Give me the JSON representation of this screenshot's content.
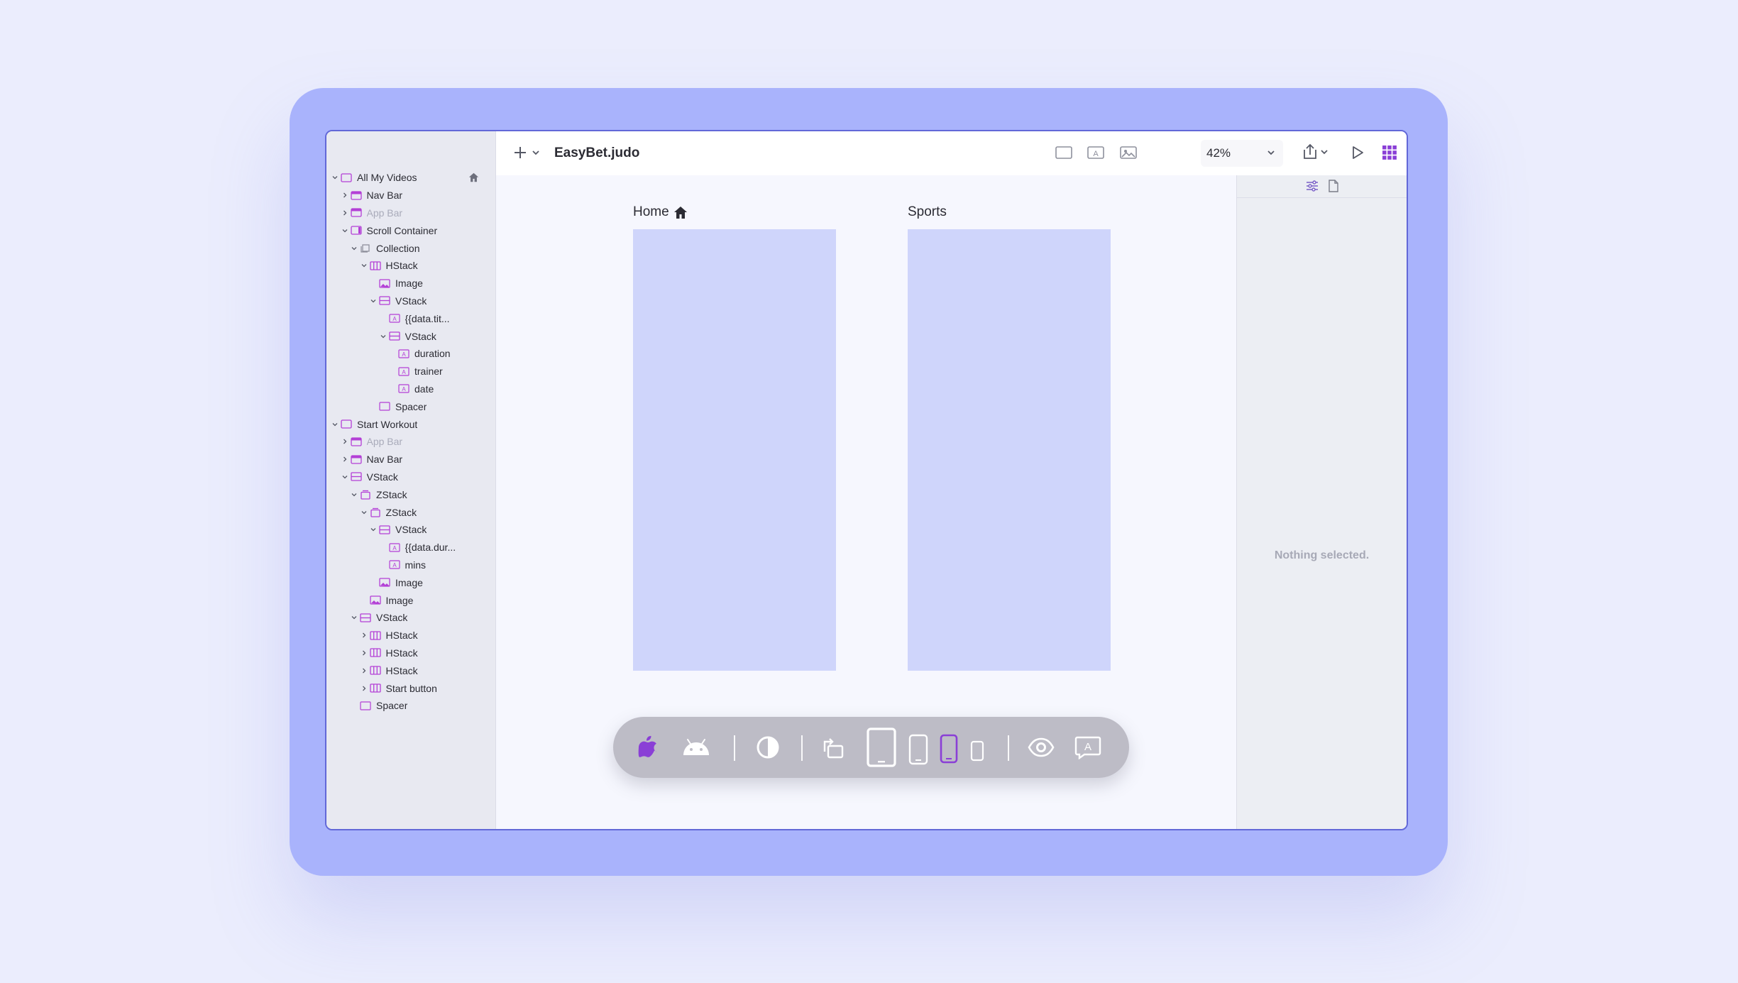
{
  "app": {
    "file_name": "EasyBet.judo",
    "zoom": "42%"
  },
  "colors": {
    "accent": "#8a3fd6",
    "frame_fill": "#cfd5fb",
    "device_bezel": "#a9b3fc"
  },
  "layers": [
    {
      "label": "All My Videos",
      "depth": 0,
      "expanded": true,
      "icon": "screen-icon",
      "dim": false,
      "home": true
    },
    {
      "label": "Nav Bar",
      "depth": 1,
      "expanded": false,
      "icon": "navbar-icon",
      "dim": false
    },
    {
      "label": "App Bar",
      "depth": 1,
      "expanded": false,
      "icon": "navbar-icon",
      "dim": true
    },
    {
      "label": "Scroll Container",
      "depth": 1,
      "expanded": true,
      "icon": "scroll-icon",
      "dim": false
    },
    {
      "label": "Collection",
      "depth": 2,
      "expanded": true,
      "icon": "collection-icon",
      "dim": false
    },
    {
      "label": "HStack",
      "depth": 3,
      "expanded": true,
      "icon": "hstack-icon",
      "dim": false
    },
    {
      "label": "Image",
      "depth": 4,
      "icon": "image-icon",
      "dim": false
    },
    {
      "label": "VStack",
      "depth": 4,
      "expanded": true,
      "icon": "vstack-icon",
      "dim": false
    },
    {
      "label": "{{data.tit...",
      "depth": 5,
      "icon": "text-icon",
      "dim": false
    },
    {
      "label": "VStack",
      "depth": 5,
      "expanded": true,
      "icon": "vstack-icon",
      "dim": false
    },
    {
      "label": "duration",
      "depth": 6,
      "icon": "text-icon",
      "dim": false
    },
    {
      "label": "trainer",
      "depth": 6,
      "icon": "text-icon",
      "dim": false
    },
    {
      "label": "date",
      "depth": 6,
      "icon": "text-icon",
      "dim": false
    },
    {
      "label": "Spacer",
      "depth": 4,
      "icon": "spacer-icon",
      "dim": false
    },
    {
      "label": "Start Workout",
      "depth": 0,
      "expanded": true,
      "icon": "screen-icon",
      "dim": false
    },
    {
      "label": "App Bar",
      "depth": 1,
      "expanded": false,
      "icon": "navbar-icon",
      "dim": true
    },
    {
      "label": "Nav Bar",
      "depth": 1,
      "expanded": false,
      "icon": "navbar-icon",
      "dim": false
    },
    {
      "label": "VStack",
      "depth": 1,
      "expanded": true,
      "icon": "vstack-icon",
      "dim": false
    },
    {
      "label": "ZStack",
      "depth": 2,
      "expanded": true,
      "icon": "zstack-icon",
      "dim": false
    },
    {
      "label": "ZStack",
      "depth": 3,
      "expanded": true,
      "icon": "zstack-icon",
      "dim": false
    },
    {
      "label": "VStack",
      "depth": 4,
      "expanded": true,
      "icon": "vstack-icon",
      "dim": false
    },
    {
      "label": "{{data.dur...",
      "depth": 5,
      "icon": "text-icon",
      "dim": false
    },
    {
      "label": "mins",
      "depth": 5,
      "icon": "text-icon",
      "dim": false
    },
    {
      "label": "Image",
      "depth": 4,
      "icon": "image-icon",
      "dim": false
    },
    {
      "label": "Image",
      "depth": 3,
      "icon": "image-icon",
      "dim": false
    },
    {
      "label": "VStack",
      "depth": 2,
      "expanded": true,
      "icon": "vstack-icon",
      "dim": false
    },
    {
      "label": "HStack",
      "depth": 3,
      "expanded": false,
      "icon": "hstack-icon",
      "dim": false
    },
    {
      "label": "HStack",
      "depth": 3,
      "expanded": false,
      "icon": "hstack-icon",
      "dim": false
    },
    {
      "label": "HStack",
      "depth": 3,
      "expanded": false,
      "icon": "hstack-icon",
      "dim": false
    },
    {
      "label": "Start button",
      "depth": 3,
      "expanded": false,
      "icon": "hstack-icon",
      "dim": false
    },
    {
      "label": "Spacer",
      "depth": 2,
      "icon": "spacer-icon",
      "dim": false
    }
  ],
  "canvas": {
    "frames": [
      {
        "label": "Home",
        "home": true
      },
      {
        "label": "Sports",
        "home": false
      }
    ]
  },
  "inspector": {
    "empty_message": "Nothing selected."
  }
}
